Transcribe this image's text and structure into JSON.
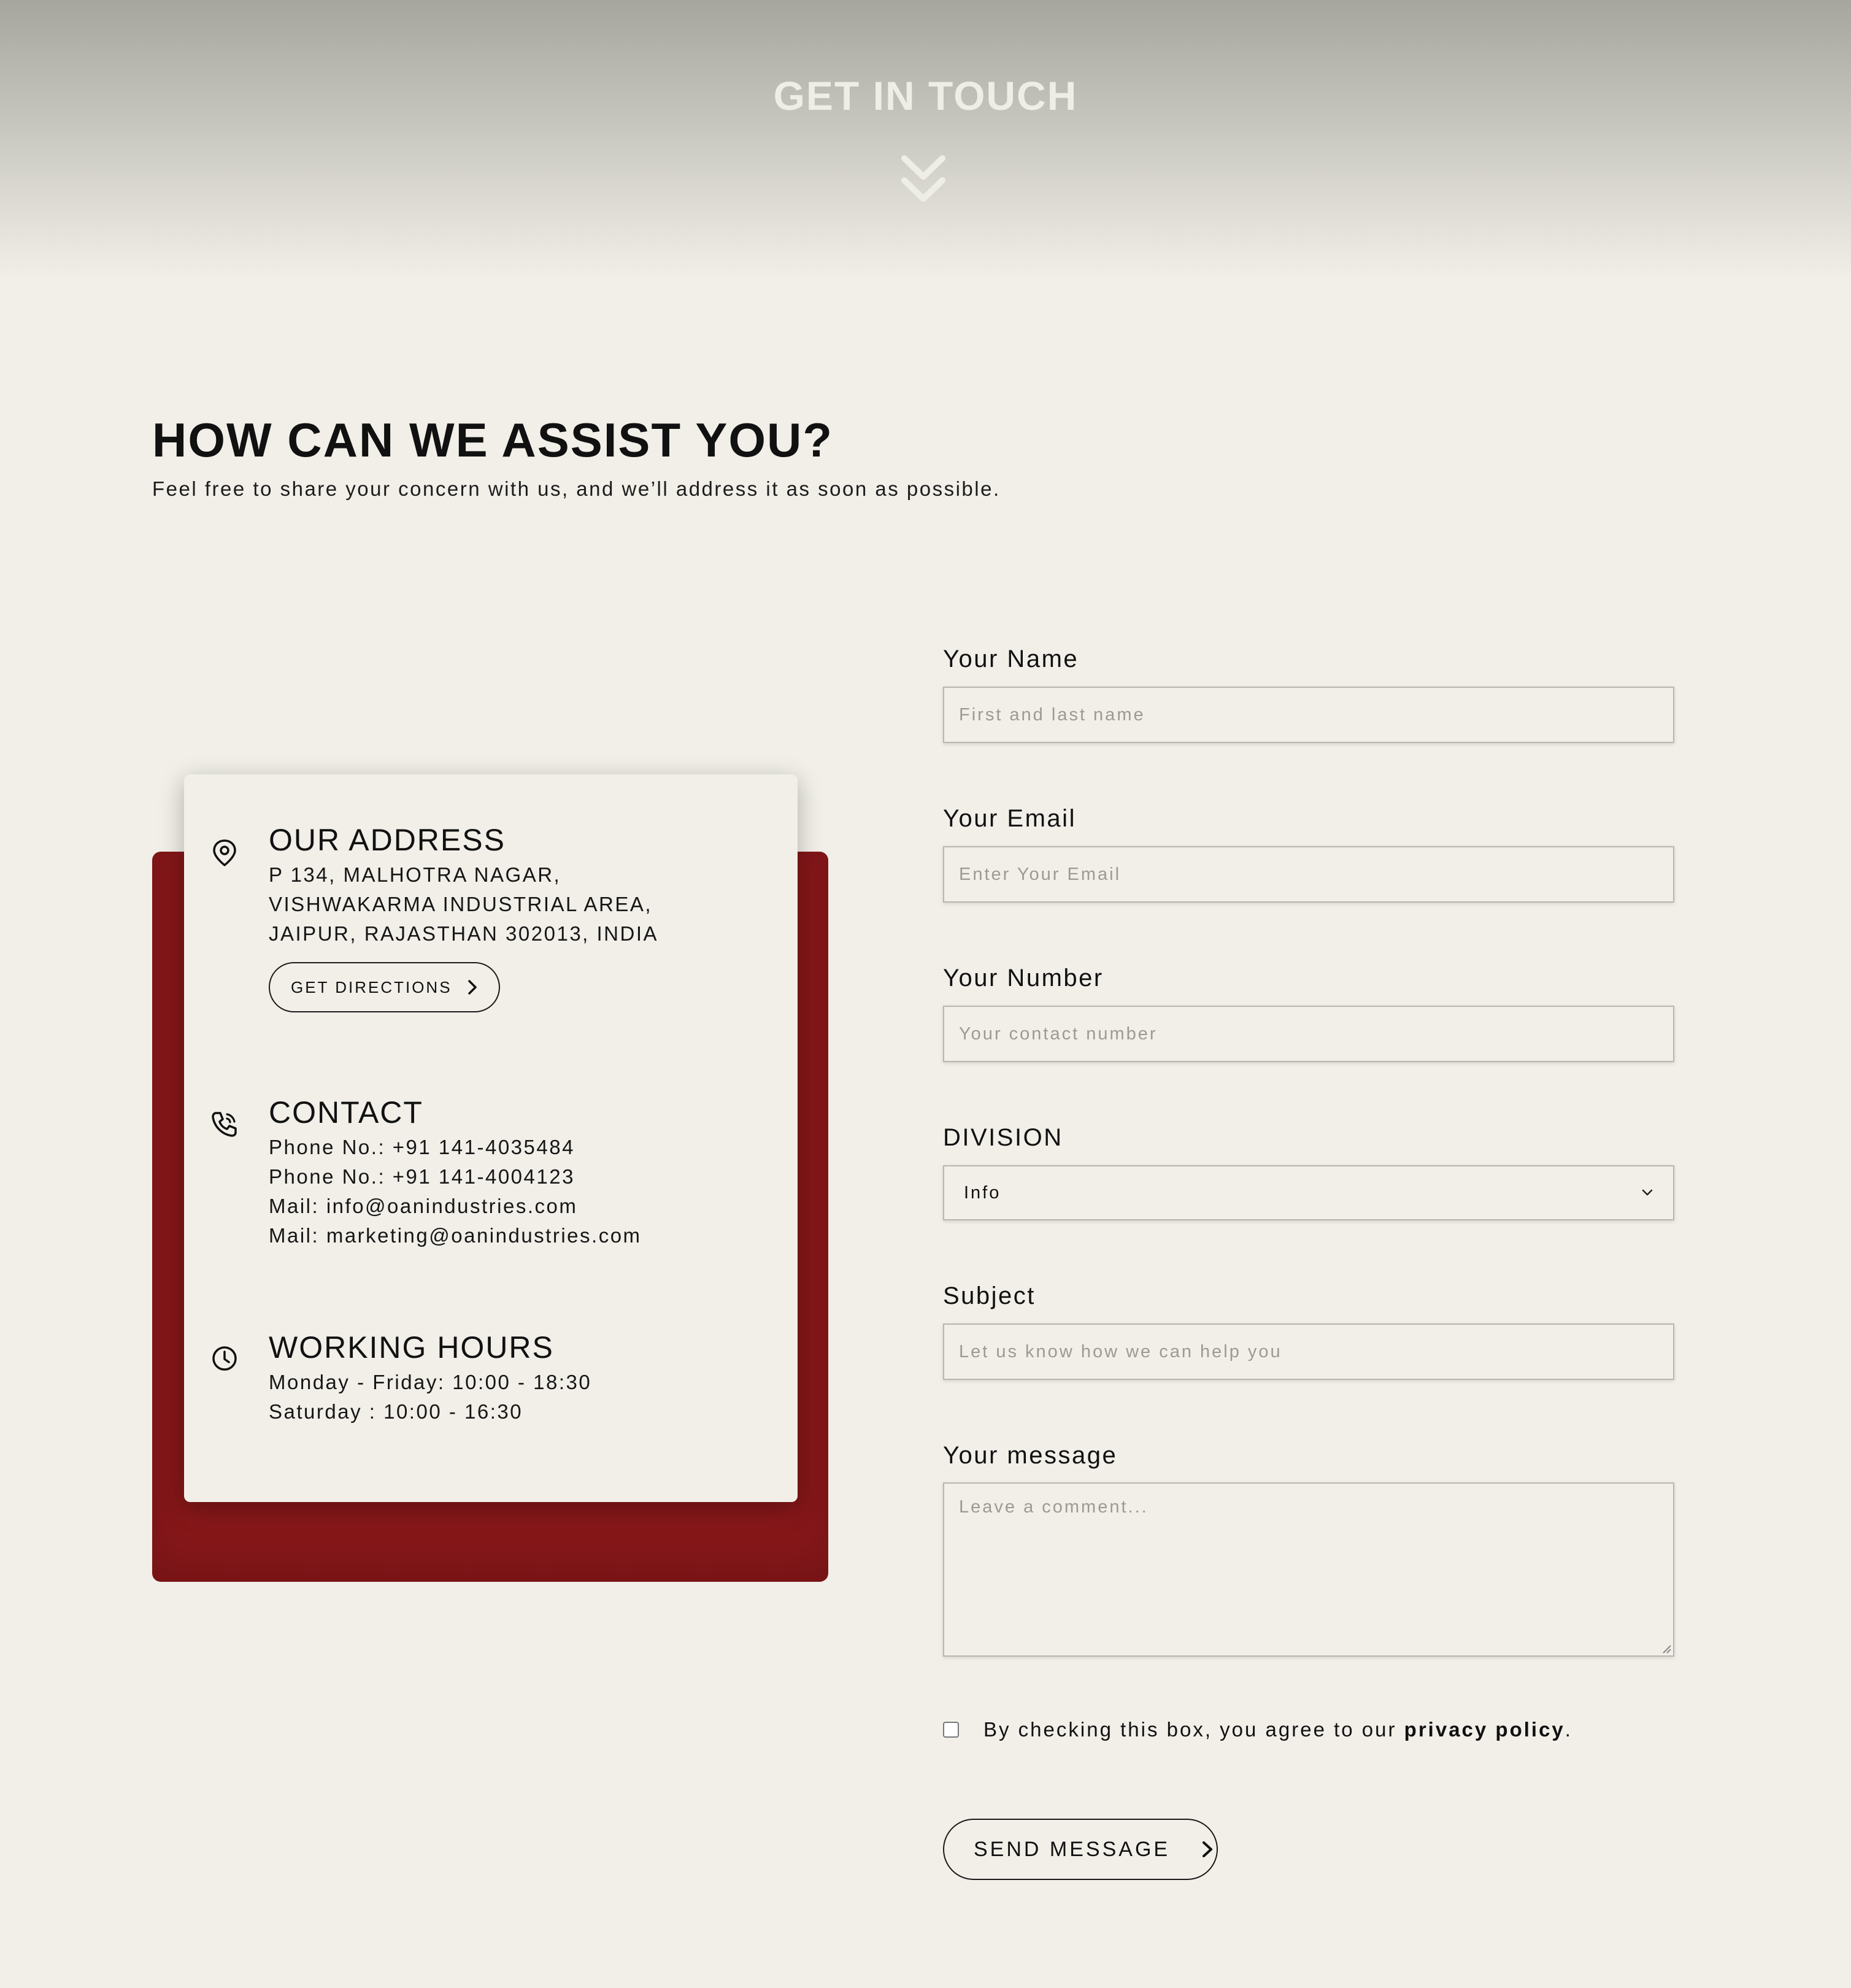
{
  "hero": {
    "title": "GET IN TOUCH",
    "icon": "double-chevron-down-icon"
  },
  "intro": {
    "title": "HOW CAN WE ASSIST YOU?",
    "subtitle": "Feel free to share your concern with us, and we’ll address it as soon as possible."
  },
  "info_card": {
    "accent_color": "#861719",
    "address": {
      "icon": "location-pin-icon",
      "heading": "OUR ADDRESS",
      "lines": [
        "P 134, MALHOTRA NAGAR,",
        "VISHWAKARMA INDUSTRIAL AREA,",
        "JAIPUR, RAJASTHAN 302013, INDIA"
      ],
      "button_label": "GET DIRECTIONS"
    },
    "contact": {
      "icon": "phone-icon",
      "heading": "CONTACT",
      "lines": [
        "Phone No.: +91 141-4035484",
        "Phone No.: +91 141-4004123",
        "Mail: info@oanindustries.com",
        "Mail: marketing@oanindustries.com"
      ]
    },
    "hours": {
      "icon": "clock-icon",
      "heading": "WORKING HOURS",
      "lines": [
        "Monday - Friday: 10:00 - 18:30",
        "Saturday : 10:00 - 16:30"
      ]
    }
  },
  "form": {
    "name": {
      "label": "Your Name",
      "placeholder": "First and last name",
      "value": ""
    },
    "email": {
      "label": "Your Email",
      "placeholder": "Enter Your Email",
      "value": ""
    },
    "number": {
      "label": "Your Number",
      "placeholder": "Your contact number",
      "value": ""
    },
    "division": {
      "label": "DIVISION",
      "selected": "Info"
    },
    "subject": {
      "label": "Subject",
      "placeholder": "Let us know how we can help you",
      "value": ""
    },
    "message": {
      "label": "Your message",
      "placeholder": "Leave a comment...",
      "value": ""
    },
    "agree": {
      "text_prefix": "By checking this box, you agree to our",
      "link_text": "privacy policy",
      "text_suffix": "."
    },
    "submit_label": "SEND MESSAGE"
  }
}
